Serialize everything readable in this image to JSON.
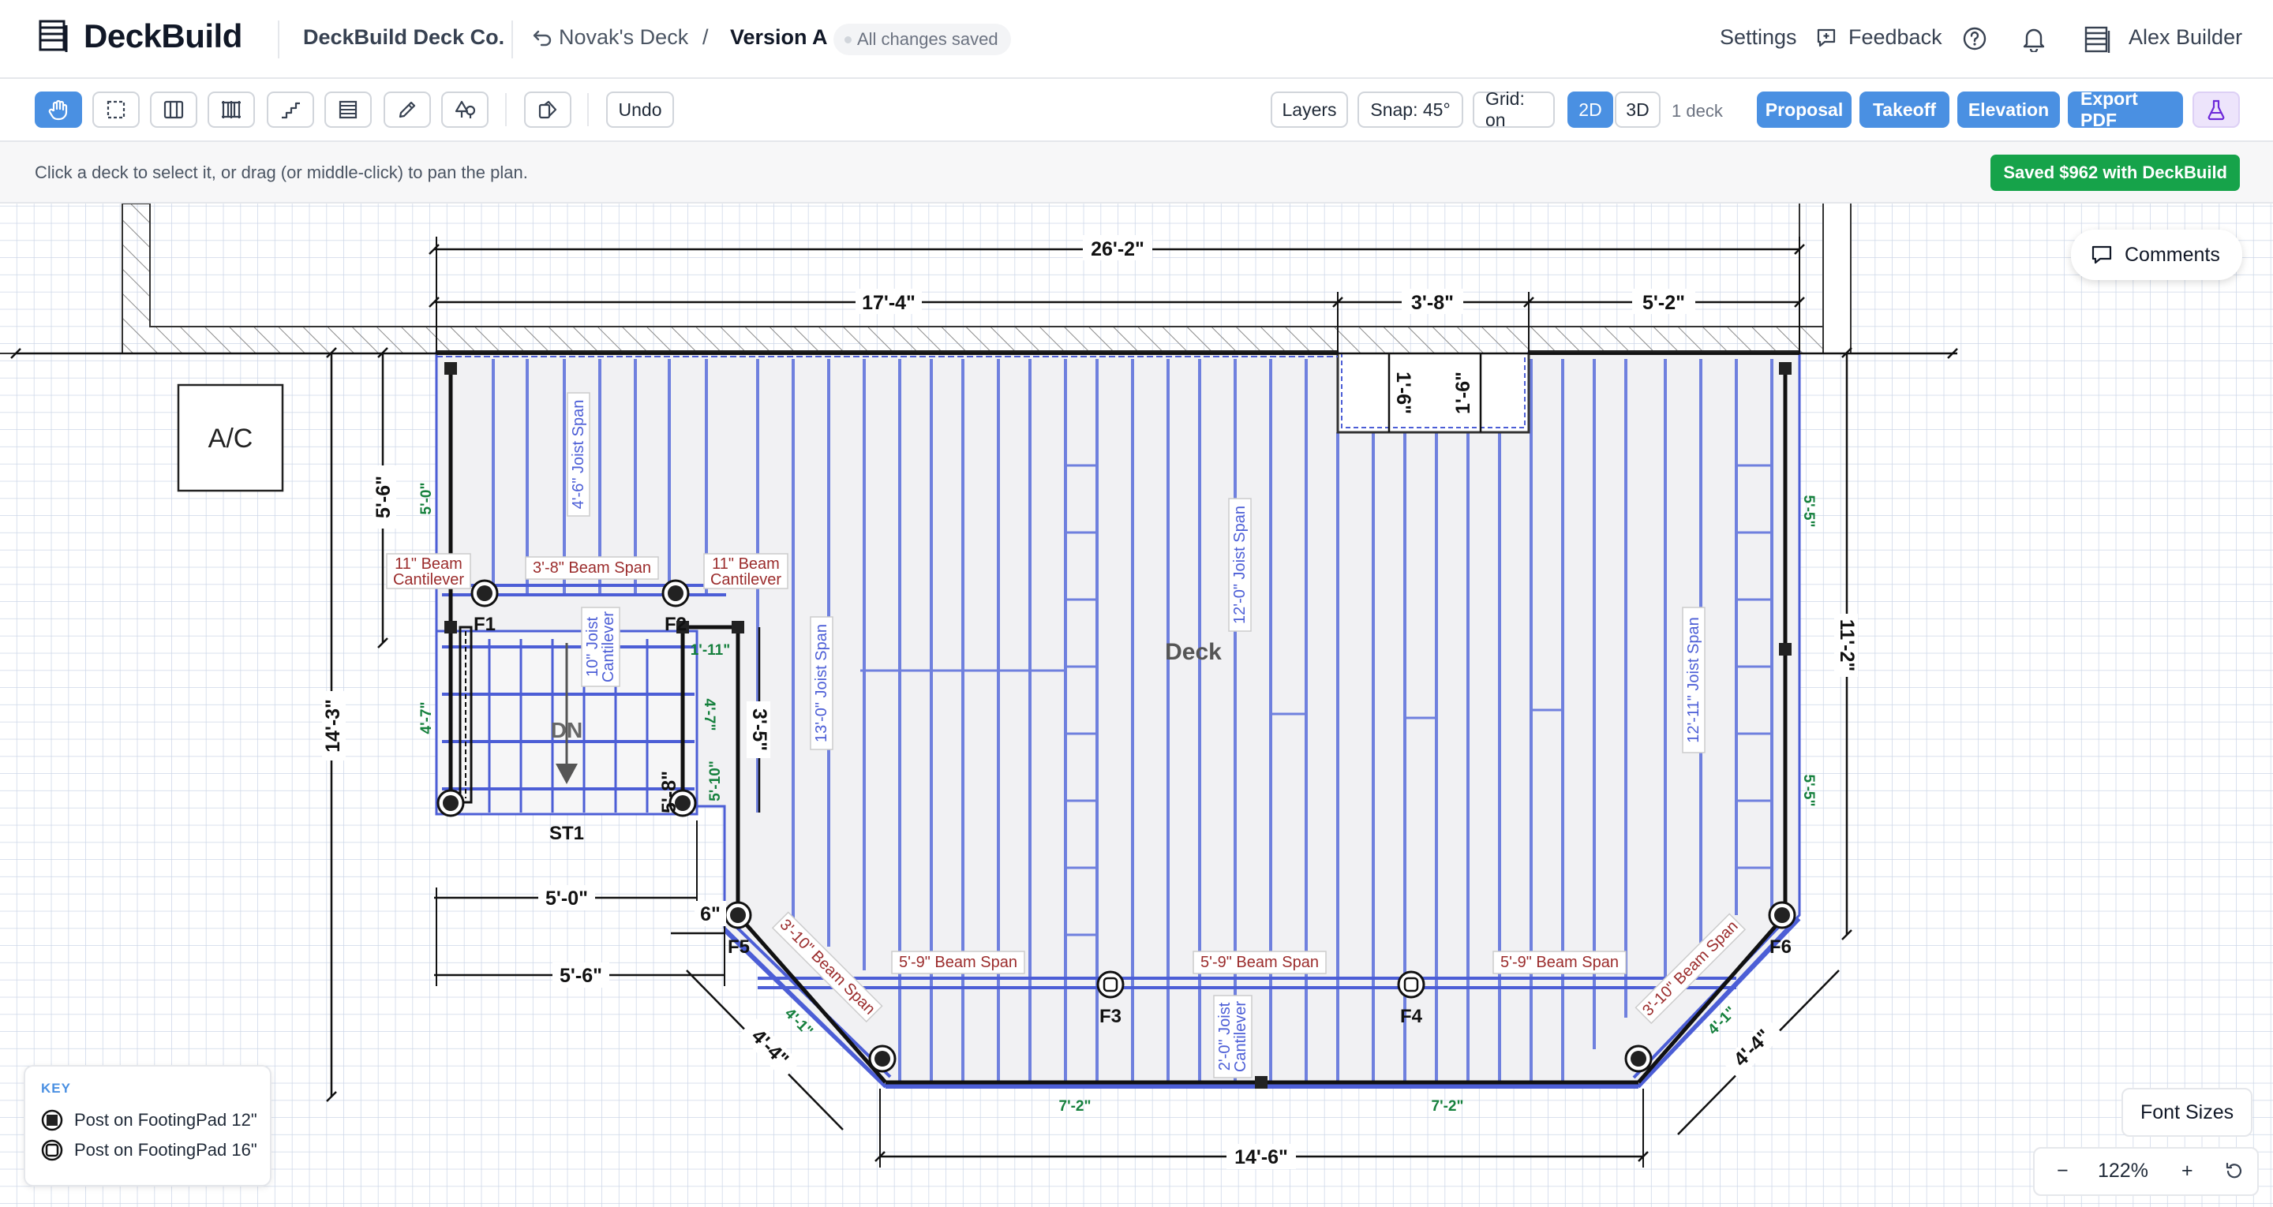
{
  "header": {
    "brand": "DeckBuild",
    "company": "DeckBuild Deck Co.",
    "project": "Novak's Deck",
    "separator": "/",
    "version": "Version A",
    "save_status": "All changes saved",
    "settings": "Settings",
    "feedback": "Feedback",
    "user": "Alex Builder"
  },
  "toolbar": {
    "tools": [
      "pan-tool",
      "select-tool",
      "joist-tool",
      "railing-tool",
      "stairs-tool",
      "board-tool",
      "draw-tool",
      "landscape-tool",
      "material-tool"
    ],
    "undo": "Undo",
    "layers": "Layers",
    "snap": "Snap: 45°",
    "grid": "Grid: on",
    "view_2d": "2D",
    "view_3d": "3D",
    "deck_count": "1 deck",
    "proposal": "Proposal",
    "takeoff": "Takeoff",
    "elevation": "Elevation",
    "export_pdf": "Export PDF"
  },
  "hint": {
    "text": "Click a deck to select it, or drag (or middle-click) to pan the plan.",
    "saved_badge": "Saved $962 with DeckBuild"
  },
  "canvas": {
    "comments": "Comments",
    "ac_label": "A/C",
    "deck_label": "Deck",
    "stair_label": "ST1",
    "stair_dir": "DN",
    "dims": {
      "top_overall": "26'-2\"",
      "top_left": "17'-4\"",
      "top_notch": "3'-8\"",
      "top_right": "5'-2\"",
      "notch_left": "1'-6\"",
      "notch_right": "1'-6\"",
      "left_overall": "14'-3\"",
      "left_upper": "5'-6\"",
      "right_overall": "11'-2\"",
      "stair_width": "5'-0\"",
      "stair_width2": "5'-6\"",
      "stair_offset": "6\"",
      "stair_depth": "3'-5\"",
      "diag_left": "4'-4\"",
      "diag_right": "4'-4\"",
      "bottom": "14'-6\""
    },
    "green_dims": [
      "5'-0\"",
      "4'-7\"",
      "1'-11\"",
      "4'-7\"",
      "5'-10\"",
      "5'-8\"",
      "4'-1\"",
      "7'-2\"",
      "7'-2\"",
      "4'-1\"",
      "5'-5\"",
      "5'-5\""
    ],
    "labels": {
      "beam_cant_1": [
        "11\" Beam",
        "Cantilever"
      ],
      "beam_cant_2": [
        "11\" Beam",
        "Cantilever"
      ],
      "beam_span_top": "3'-8\" Beam Span",
      "joist_span_a": "4'-6\" Joist Span",
      "joist_cant_a": [
        "10\" Joist",
        "Cantilever"
      ],
      "joist_span_b": "13'-0\" Joist Span",
      "joist_span_c": "12'-0\" Joist Span",
      "joist_span_d": "12'-11\" Joist Span",
      "beam_span_diag_l": "3'-10\" Beam Span",
      "beam_span_diag_r": "3'-10\" Beam Span",
      "beam_span_1": "5'-9\" Beam Span",
      "beam_span_2": "5'-9\" Beam Span",
      "beam_span_3": "5'-9\" Beam Span",
      "joist_cant_b": [
        "2'-0\" Joist",
        "Cantilever"
      ]
    },
    "footings": [
      "F1",
      "F2",
      "F3",
      "F4",
      "F5",
      "F6"
    ]
  },
  "legend": {
    "title": "KEY",
    "items": [
      "Post on FootingPad 12\"",
      "Post on FootingPad 16\""
    ]
  },
  "footer": {
    "font_sizes": "Font Sizes",
    "zoom_out": "−",
    "zoom_level": "122%",
    "zoom_in": "+"
  },
  "colors": {
    "accent": "#4a90e2",
    "saved": "#16a34a",
    "beam_label": "#9b2c2c",
    "dim_green": "#15803d",
    "joist": "#5b6fd6"
  }
}
